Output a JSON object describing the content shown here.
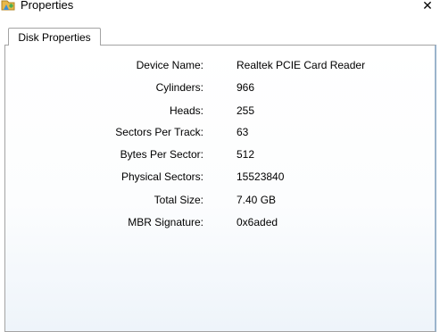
{
  "window": {
    "title": "Properties",
    "close_glyph": "✕"
  },
  "tabs": [
    {
      "label": "Disk Properties",
      "selected": true
    }
  ],
  "properties": [
    {
      "label": "Device Name:",
      "value": "Realtek PCIE Card Reader"
    },
    {
      "label": "Cylinders:",
      "value": "966"
    },
    {
      "label": "Heads:",
      "value": "255"
    },
    {
      "label": "Sectors Per Track:",
      "value": "63"
    },
    {
      "label": "Bytes Per Sector:",
      "value": "512"
    },
    {
      "label": "Physical Sectors:",
      "value": "15523840"
    },
    {
      "label": "Total Size:",
      "value": "7.40 GB"
    },
    {
      "label": "MBR Signature:",
      "value": "0x6aded"
    }
  ],
  "colors": {
    "border": "#a3a3a3",
    "panel_gradient_bottom": "#eef4fa",
    "right_edge": "#9bb4cc"
  }
}
